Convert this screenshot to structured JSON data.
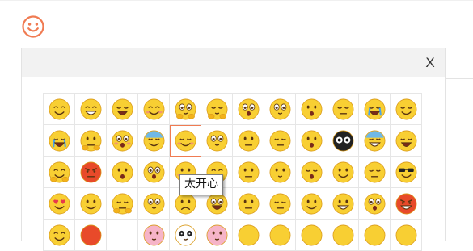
{
  "emoji_trigger": {
    "icon": "smiley-outline-icon",
    "color": "#f07b52"
  },
  "panel": {
    "close_label": "X",
    "hover_index": 16,
    "highlight_color": "#f07b52"
  },
  "tooltip": {
    "text": "太开心"
  },
  "emoji_grid": {
    "columns": 12,
    "items": [
      {
        "name": "smile",
        "face": "#f8cf33",
        "eyes": "happy",
        "mouth": "smile"
      },
      {
        "name": "grin",
        "face": "#f8cf33",
        "eyes": "happy",
        "mouth": "teeth"
      },
      {
        "name": "laugh",
        "face": "#f8cf33",
        "eyes": "closed",
        "mouth": "open"
      },
      {
        "name": "blush-smile",
        "face": "#f8cf33",
        "eyes": "happy",
        "mouth": "smile",
        "blush": true
      },
      {
        "name": "cover-face",
        "face": "#f8cf33",
        "eyes": "big",
        "mouth": "small",
        "hands": true
      },
      {
        "name": "shh",
        "face": "#f8cf33",
        "eyes": "closed",
        "mouth": "small",
        "hands": true
      },
      {
        "name": "shocked",
        "face": "#f8cf33",
        "eyes": "big",
        "mouth": "o"
      },
      {
        "name": "stare",
        "face": "#f8cf33",
        "eyes": "big",
        "mouth": "small"
      },
      {
        "name": "surprised",
        "face": "#f8cf33",
        "eyes": "dot",
        "mouth": "o"
      },
      {
        "name": "pout",
        "face": "#f8cf33",
        "eyes": "closed",
        "mouth": "flat"
      },
      {
        "name": "cry-loud",
        "face": "#f8cf33",
        "eyes": "tears",
        "mouth": "open"
      },
      {
        "name": "content",
        "face": "#f8cf33",
        "eyes": "closed",
        "mouth": "smile"
      },
      {
        "name": "weep",
        "face": "#f8cf33",
        "eyes": "tears",
        "mouth": "open"
      },
      {
        "name": "think",
        "face": "#f8cf33",
        "eyes": "dot",
        "mouth": "flat",
        "hands": true
      },
      {
        "name": "dazed",
        "face": "#f8cf33",
        "eyes": "big",
        "mouth": "o",
        "blush": true
      },
      {
        "name": "cold-sweat",
        "face": "#f8cf33",
        "eyes": "closed",
        "mouth": "smile",
        "top": "#6fb8e6"
      },
      {
        "name": "very-happy",
        "face": "#f8cf33",
        "eyes": "closed",
        "mouth": "smile",
        "blush": true
      },
      {
        "name": "wide-eyes",
        "face": "#f8cf33",
        "eyes": "big",
        "mouth": "small"
      },
      {
        "name": "puzzled",
        "face": "#f8cf33",
        "eyes": "dot",
        "mouth": "flat"
      },
      {
        "name": "squint",
        "face": "#f8cf33",
        "eyes": "closed",
        "mouth": "flat"
      },
      {
        "name": "gasp",
        "face": "#f8cf33",
        "eyes": "dot",
        "mouth": "o"
      },
      {
        "name": "dark-eyes",
        "face": "#222222",
        "eyes": "white",
        "mouth": "none"
      },
      {
        "name": "freezing",
        "face": "#f8cf33",
        "eyes": "closed",
        "mouth": "teeth",
        "top": "#6fb8e6"
      },
      {
        "name": "tongue",
        "face": "#f8cf33",
        "eyes": "closed",
        "mouth": "open"
      },
      {
        "name": "hug",
        "face": "#f8cf33",
        "eyes": "happy",
        "mouth": "smile",
        "hands": true
      },
      {
        "name": "angry",
        "face": "#e84a2a",
        "eyes": "angry",
        "mouth": "flat"
      },
      {
        "name": "question",
        "face": "#f8cf33",
        "eyes": "dot",
        "mouth": "o"
      },
      {
        "name": "dizzy",
        "face": "#f8cf33",
        "eyes": "big",
        "mouth": "o"
      },
      {
        "name": "bashful",
        "face": "#f8cf33",
        "eyes": "dot",
        "mouth": "small",
        "blush": true
      },
      {
        "name": "wink",
        "face": "#f8cf33",
        "eyes": "happy",
        "mouth": "smile"
      },
      {
        "name": "side-eye",
        "face": "#f8cf33",
        "eyes": "dot",
        "mouth": "flat"
      },
      {
        "name": "doubt",
        "face": "#f8cf33",
        "eyes": "dot",
        "mouth": "small"
      },
      {
        "name": "sleepy",
        "face": "#f8cf33",
        "eyes": "closed",
        "mouth": "o"
      },
      {
        "name": "money",
        "face": "#f8cf33",
        "eyes": "dot",
        "mouth": "smile"
      },
      {
        "name": "tired",
        "face": "#f8cf33",
        "eyes": "closed",
        "mouth": "flat"
      },
      {
        "name": "cool",
        "face": "#f8cf33",
        "eyes": "shades",
        "mouth": "smile"
      },
      {
        "name": "heart-eyes",
        "face": "#f8cf33",
        "eyes": "hearts",
        "mouth": "smile"
      },
      {
        "name": "sly",
        "face": "#f8cf33",
        "eyes": "dot",
        "mouth": "smile"
      },
      {
        "name": "sick",
        "face": "#f8cf33",
        "eyes": "closed",
        "mouth": "flat",
        "hands": true
      },
      {
        "name": "swirl",
        "face": "#f8cf33",
        "eyes": "big",
        "mouth": "small"
      },
      {
        "name": "sad",
        "face": "#f8cf33",
        "eyes": "dot",
        "mouth": "frown"
      },
      {
        "name": "scream",
        "face": "#f8cf33",
        "eyes": "big",
        "mouth": "open"
      },
      {
        "name": "peek",
        "face": "#f8cf33",
        "eyes": "dot",
        "mouth": "flat"
      },
      {
        "name": "meh",
        "face": "#f8cf33",
        "eyes": "closed",
        "mouth": "flat"
      },
      {
        "name": "smirk",
        "face": "#f8cf33",
        "eyes": "dot",
        "mouth": "smile"
      },
      {
        "name": "badge",
        "face": "#f8cf33",
        "eyes": "dot",
        "mouth": "teeth"
      },
      {
        "name": "hypnotized",
        "face": "#f8cf33",
        "eyes": "big",
        "mouth": "o"
      },
      {
        "name": "furious",
        "face": "#e84a2a",
        "eyes": "angry",
        "mouth": "teeth"
      },
      {
        "name": "partial-smile",
        "face": "#f8cf33",
        "eyes": "happy",
        "mouth": "smile"
      },
      {
        "name": "broken-heart",
        "face": "#e84a2a",
        "eyes": "none",
        "mouth": "none"
      },
      {
        "name": "empty",
        "face": "",
        "eyes": "none",
        "mouth": "none"
      },
      {
        "name": "pig",
        "face": "#f6b4c8",
        "eyes": "dot",
        "mouth": "small"
      },
      {
        "name": "panda",
        "face": "#ffffff",
        "eyes": "panda",
        "mouth": "small"
      },
      {
        "name": "bunny",
        "face": "#f6b4c8",
        "eyes": "dot",
        "mouth": "small"
      },
      {
        "name": "gesture-a",
        "face": "#f8cf33",
        "eyes": "none",
        "mouth": "none"
      },
      {
        "name": "gesture-b",
        "face": "#f8cf33",
        "eyes": "none",
        "mouth": "none"
      },
      {
        "name": "gesture-c",
        "face": "#f8cf33",
        "eyes": "none",
        "mouth": "none"
      },
      {
        "name": "gesture-d",
        "face": "#f8cf33",
        "eyes": "none",
        "mouth": "none"
      },
      {
        "name": "gesture-e",
        "face": "#f8cf33",
        "eyes": "none",
        "mouth": "none"
      },
      {
        "name": "gesture-f",
        "face": "#f8cf33",
        "eyes": "none",
        "mouth": "none"
      }
    ]
  }
}
